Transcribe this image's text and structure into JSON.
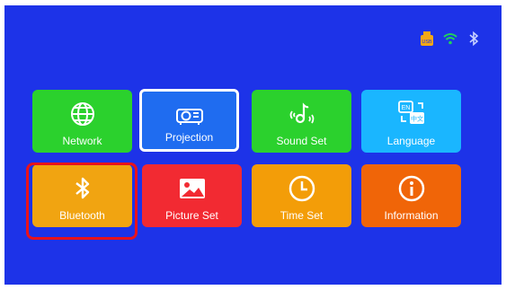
{
  "status": {
    "usb_label": "USB",
    "icons": [
      "usb-icon",
      "wifi-icon",
      "bluetooth-icon"
    ]
  },
  "tiles": [
    {
      "label": "Network",
      "icon": "globe-icon",
      "color": "#2bd12d"
    },
    {
      "label": "Projection",
      "icon": "projector-icon",
      "color": "#1f6cf0",
      "selected": true
    },
    {
      "label": "Sound Set",
      "icon": "music-note-icon",
      "color": "#2bd12d"
    },
    {
      "label": "Language",
      "icon": "language-icon",
      "color": "#1ab6ff"
    },
    {
      "label": "Bluetooth",
      "icon": "bluetooth-icon",
      "color": "#f1a411",
      "focused": true
    },
    {
      "label": "Picture Set",
      "icon": "image-icon",
      "color": "#f22a32"
    },
    {
      "label": "Time Set",
      "icon": "clock-icon",
      "color": "#f39d08"
    },
    {
      "label": "Information",
      "icon": "info-icon",
      "color": "#f06508"
    }
  ],
  "language_icon_text": {
    "en": "EN",
    "zh": "中文"
  },
  "colors": {
    "background": "#1d33e8",
    "focus_ring": "#e8121c"
  }
}
